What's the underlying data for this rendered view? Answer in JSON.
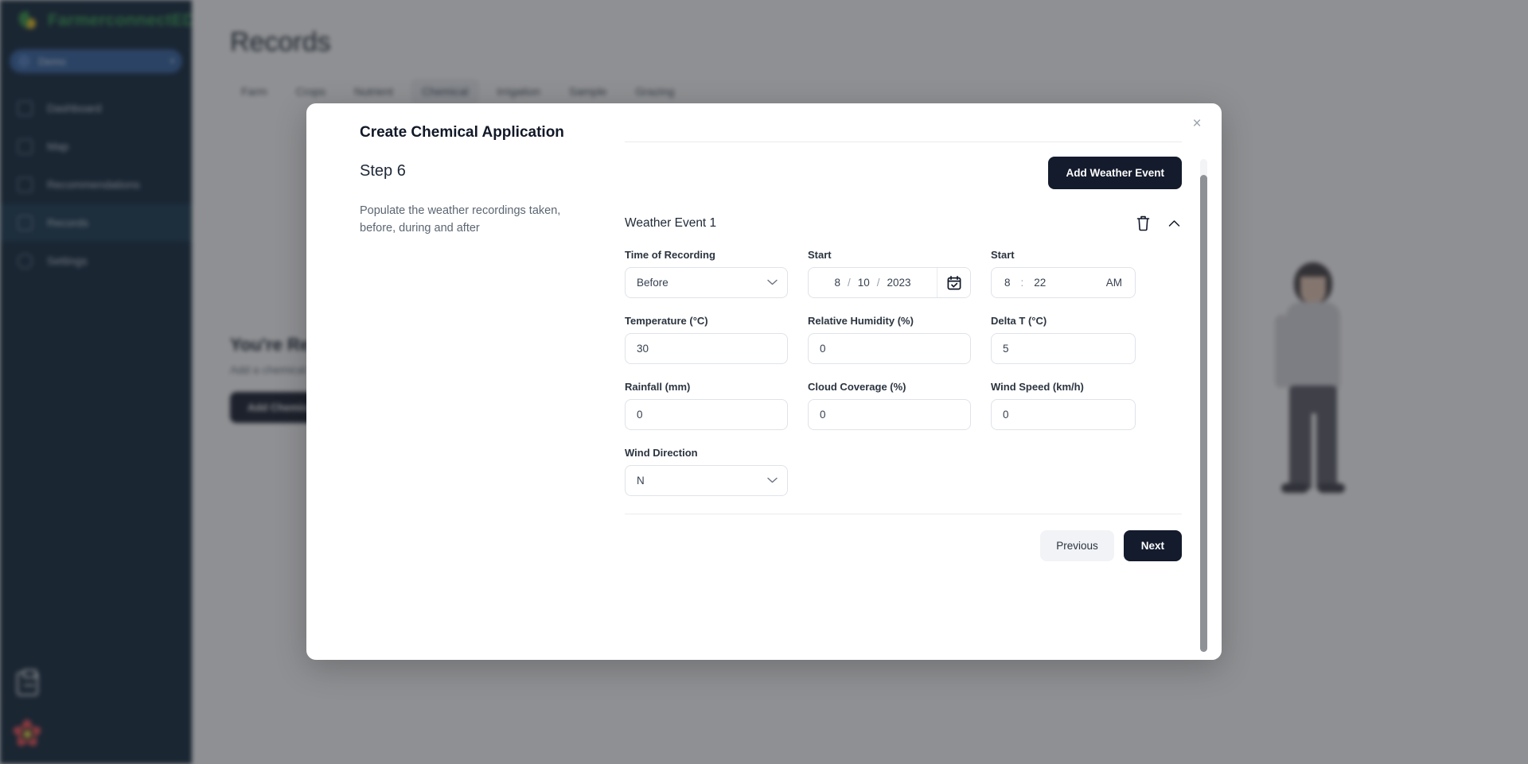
{
  "sidebar": {
    "brand": "FarmerconnectED",
    "collapse_icon": "chevron-left-icon",
    "farm_selector": {
      "label": "Demo",
      "caret": "▾"
    },
    "items": [
      {
        "label": "Dashboard",
        "icon": "dashboard-icon",
        "active": false
      },
      {
        "label": "Map",
        "icon": "map-icon",
        "active": false
      },
      {
        "label": "Recommendations",
        "icon": "recommendations-icon",
        "active": false
      },
      {
        "label": "Records",
        "icon": "records-icon",
        "active": true
      },
      {
        "label": "Settings",
        "icon": "gear-icon",
        "active": false
      }
    ],
    "tools": [
      {
        "name": "clipboard-import-icon"
      },
      {
        "name": "flower-logo"
      }
    ]
  },
  "page": {
    "title": "Records",
    "tabs": [
      {
        "label": "Farm",
        "active": false
      },
      {
        "label": "Crops",
        "active": false
      },
      {
        "label": "Nutrient",
        "active": false
      },
      {
        "label": "Chemical",
        "active": true
      },
      {
        "label": "Irrigation",
        "active": false
      },
      {
        "label": "Sample",
        "active": false
      },
      {
        "label": "Grazing",
        "active": false
      }
    ],
    "empty_state": {
      "title": "You're Ready",
      "subtitle": "Add a chemical application record",
      "button": "Add Chemical"
    }
  },
  "modal": {
    "title": "Create Chemical Application",
    "step": "Step 6",
    "description": "Populate the weather recordings taken, before, during and after",
    "close_icon": "close-icon",
    "add_event_button": "Add Weather Event",
    "event": {
      "title": "Weather Event 1",
      "delete_icon": "trash-icon",
      "collapse_icon": "chevron-up-icon",
      "fields": {
        "time_of_recording": {
          "label": "Time of Recording",
          "value": "Before",
          "caret": "⌄"
        },
        "start_date": {
          "label": "Start",
          "month": "8",
          "day": "10",
          "year": "2023",
          "separator": "/",
          "calendar_icon": "calendar-check-icon"
        },
        "start_time": {
          "label": "Start",
          "hour": "8",
          "minute": "22",
          "separator": ":",
          "meridiem": "AM"
        },
        "temperature": {
          "label": "Temperature (°C)",
          "value": "30"
        },
        "relative_humidity": {
          "label": "Relative Humidity (%)",
          "value": "0"
        },
        "delta_t": {
          "label": "Delta T (°C)",
          "value": "5"
        },
        "rainfall": {
          "label": "Rainfall (mm)",
          "value": "0"
        },
        "cloud_coverage": {
          "label": "Cloud Coverage (%)",
          "value": "0"
        },
        "wind_speed": {
          "label": "Wind Speed (km/h)",
          "value": "0"
        },
        "wind_direction": {
          "label": "Wind Direction",
          "value": "N",
          "caret": "⌄"
        }
      }
    },
    "footer": {
      "previous": "Previous",
      "next": "Next"
    }
  },
  "colors": {
    "sidebar_bg": "#0b2236",
    "brand_green": "#2f9b4a",
    "dark_button": "#141b2d",
    "light_button": "#f1f3f6",
    "active_nav": "#123249"
  }
}
